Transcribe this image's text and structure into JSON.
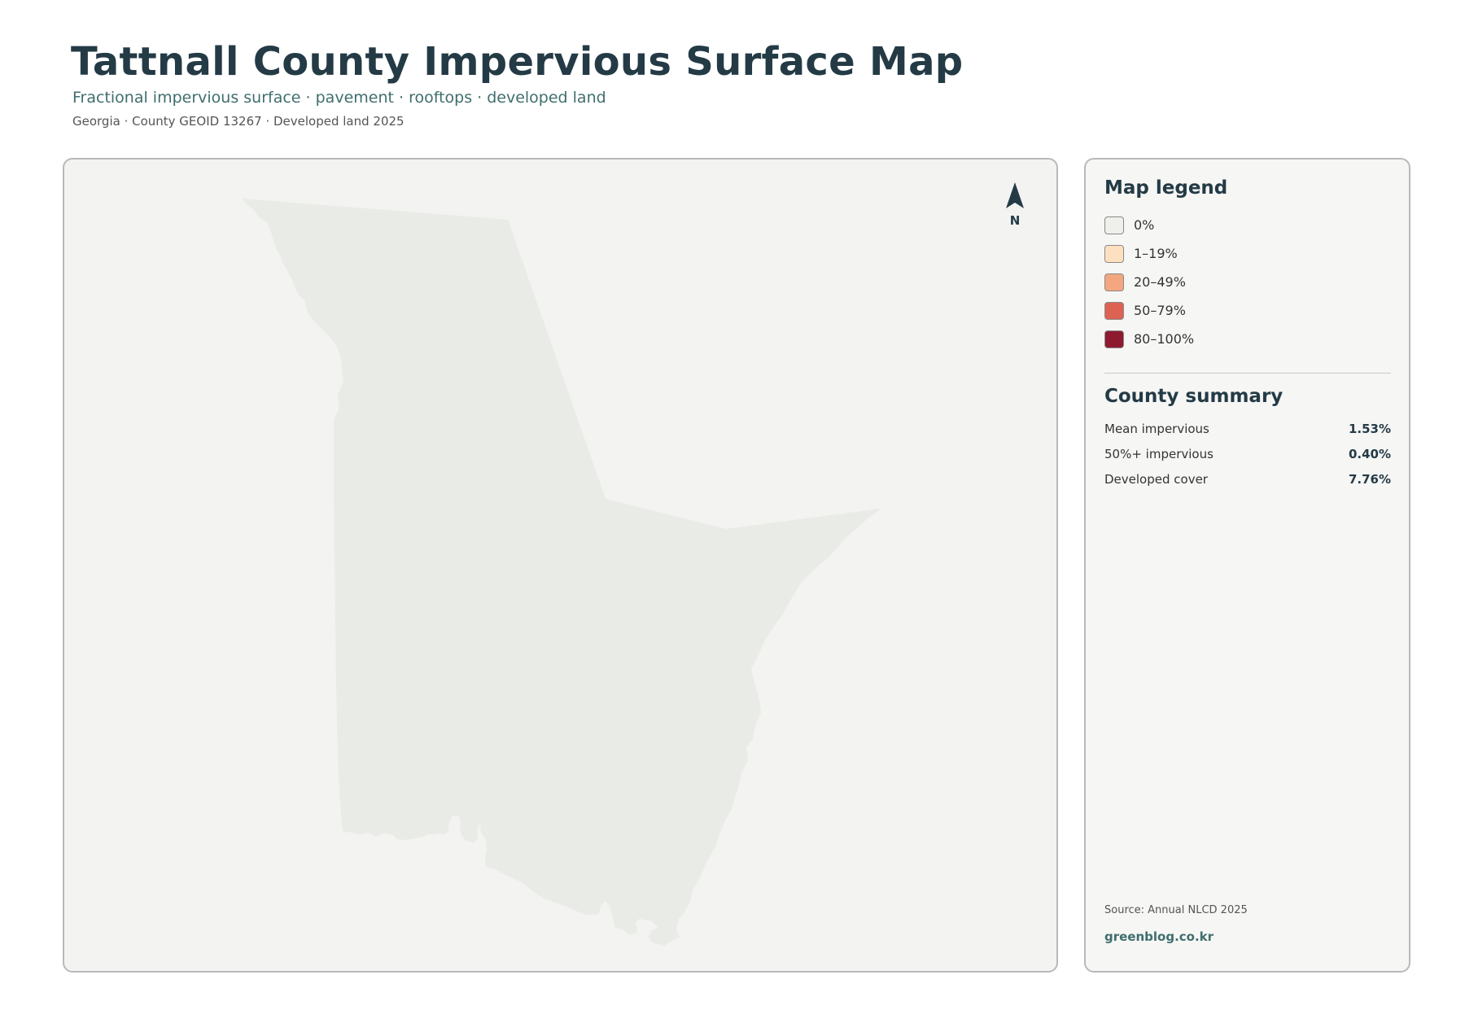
{
  "header": {
    "title": "Tattnall County Impervious Surface Map",
    "subtitle": "Fractional impervious surface · pavement · rooftops · developed land",
    "meta": "Georgia · County GEOID 13267 · Developed land 2025"
  },
  "map": {
    "north_label": "N",
    "fill_color": "#e9ece6",
    "border_color": "#243b46",
    "road_color": "#f4a27a"
  },
  "legend": {
    "title": "Map legend",
    "items": [
      {
        "label": "0%",
        "color": "#efefeb"
      },
      {
        "label": "1–19%",
        "color": "#fde0c0"
      },
      {
        "label": "20–49%",
        "color": "#f4a67e"
      },
      {
        "label": "50–79%",
        "color": "#dd6251"
      },
      {
        "label": "80–100%",
        "color": "#8e1a30"
      }
    ]
  },
  "summary": {
    "title": "County summary",
    "stats": [
      {
        "label": "Mean impervious",
        "value": "1.53%"
      },
      {
        "label": "50%+ impervious",
        "value": "0.40%"
      },
      {
        "label": "Developed cover",
        "value": "7.76%"
      }
    ]
  },
  "footer": {
    "source": "Source: Annual NLCD 2025",
    "website": "greenblog.co.kr"
  }
}
